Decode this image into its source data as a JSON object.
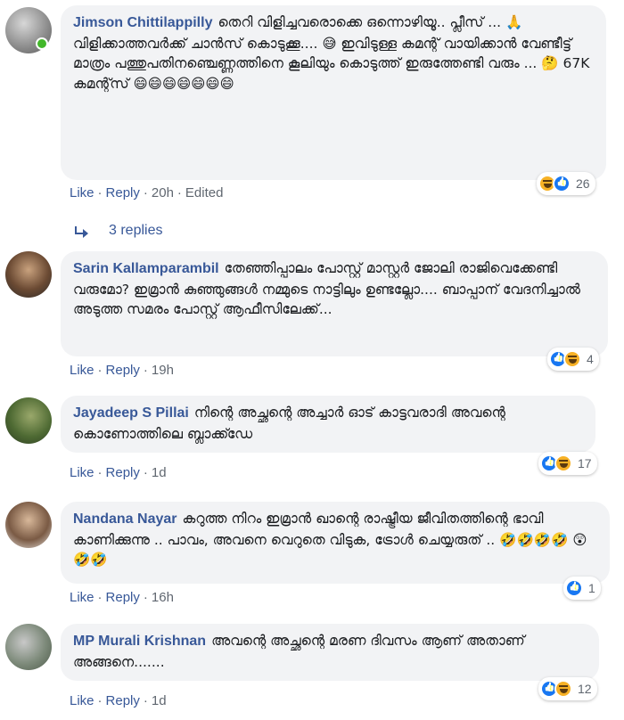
{
  "comments": [
    {
      "author": "Jimson Chittilappilly",
      "text": "തെറി വിളിച്ചവരൊക്കെ ഒന്നൊഴിയൂ.. പ്ലീസ് ... 🙏 വിളിക്കാത്തവർക്ക് ചാൻസ് കൊടുക്കൂ.... 😅 ഇവിടുള്ള കമന്റ് വായിക്കാൻ വേണ്ടീട്ട് മാത്രം പത്തുപതിനഞ്ചെണ്ണത്തിനെ കൂലിയും കൊടുത്ത് ഇരുത്തേണ്ടി വരും ... 🤔 67K കമന്റ്സ് 😄😄😄😄😄😄😄",
      "like_label": "Like",
      "reply_label": "Reply",
      "time": "20h",
      "edited": "Edited",
      "reaction_count": "26",
      "replies_label": "3 replies"
    },
    {
      "author": "Sarin Kallamparambil",
      "text": "തേഞ്ഞിപ്പാലം പോസ്റ്റ് മാസ്റ്റർ ജോലി രാജിവെക്കേണ്ടി വരുമോ? ഇമ്രാൻ കുഞ്ഞുങ്ങൾ നമ്മുടെ നാട്ടിലും ഉണ്ടല്ലോ.... ബാപ്പാന് വേദനിച്ചാൽ അടുത്ത സമരം പോസ്റ്റ് ആഫീസിലേക്ക്...",
      "like_label": "Like",
      "reply_label": "Reply",
      "time": "19h",
      "reaction_count": "4"
    },
    {
      "author": "Jayadeep S Pillai",
      "text": "നിന്റെ അച്ഛന്റെ അച്ചാർ ഓട് കാട്ടവരാദി അവന്റെ കൊണോത്തിലെ ബ്ലാക്ക്ഡേ",
      "like_label": "Like",
      "reply_label": "Reply",
      "time": "1d",
      "reaction_count": "17"
    },
    {
      "author": "Nandana Nayar",
      "text": "കറുത്ത നിറം ഇമ്രാൻ ഖാന്റെ രാഷ്ട്രീയ ജീവിതത്തിന്റെ ഭാവി കാണിക്കുന്നു .. പാവം, അവനെ വെറുതെ വിടുക, ട്രോൾ ചെയ്യരുത് .. 🤣🤣🤣🤣 😲🤣🤣",
      "like_label": "Like",
      "reply_label": "Reply",
      "time": "16h",
      "reaction_count": "1"
    },
    {
      "author": "MP Murali Krishnan",
      "text": "അവന്റെ അച്ഛന്റെ മരണ ദിവസം ആണ് അതാണ് അങ്ങനെ.......",
      "like_label": "Like",
      "reply_label": "Reply",
      "time": "1d",
      "reaction_count": "12"
    }
  ],
  "colors": {
    "author": "#385898",
    "bubble": "#f2f3f5",
    "meta": "#606770",
    "like": "#1877f2",
    "haha": "#f7b125",
    "online": "#42b72a"
  },
  "icons": {
    "reply_arrow": "reply-arrow-icon",
    "like": "like-reaction-icon",
    "haha": "haha-reaction-icon"
  }
}
